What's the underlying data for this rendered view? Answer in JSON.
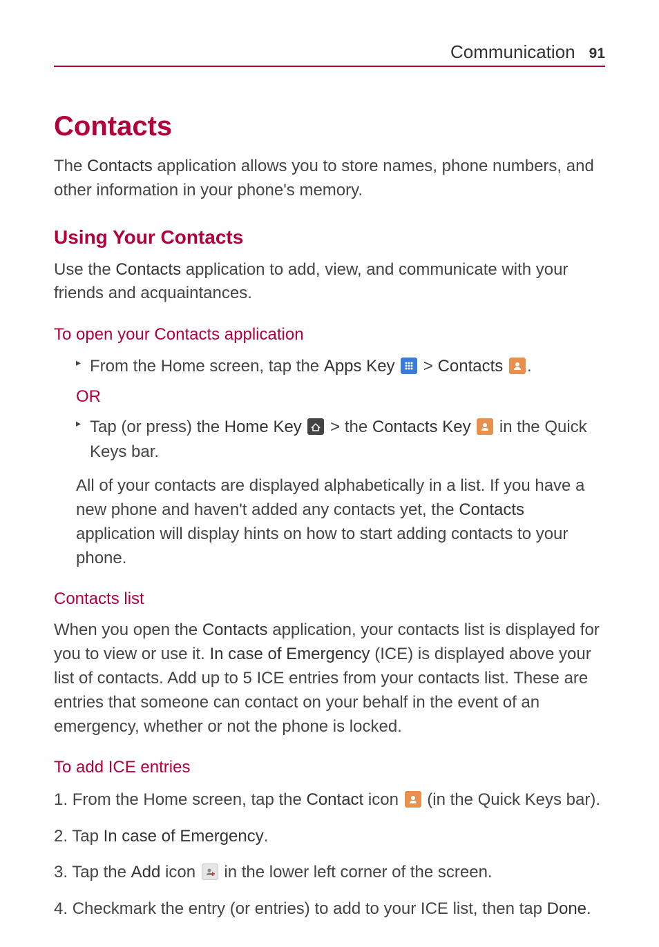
{
  "header": {
    "section": "Communication",
    "page_number": "91"
  },
  "title": "Contacts",
  "intro": {
    "prefix": "The ",
    "app_name": "Contacts",
    "suffix": " application allows you to store names, phone numbers, and other information in your phone's memory."
  },
  "using_heading": "Using Your Contacts",
  "using_text": {
    "prefix": "Use the ",
    "app_name": "Contacts",
    "suffix": " application to add, view, and communicate with your friends and acquaintances."
  },
  "open_heading": "To open your Contacts application",
  "open_bullet1": {
    "p1": "From the Home screen, tap the ",
    "apps_key": "Apps Key",
    "gt": " > ",
    "contacts": "Contacts",
    "period": "."
  },
  "or_label": "OR",
  "open_bullet2": {
    "p1": "Tap (or press) the ",
    "home_key": "Home Key",
    "gt": " > the ",
    "contacts_key": "Contacts Key",
    "suffix": " in the Quick Keys bar."
  },
  "open_para": {
    "p1": "All of your contacts are displayed alphabetically in a list. If you have a new phone and haven't added any contacts yet, the ",
    "contacts": "Contacts",
    "p2": " application will display hints on how to start adding contacts to your phone."
  },
  "list_heading": "Contacts list",
  "list_para": {
    "p1": "When you open the ",
    "contacts": "Contacts",
    "p2": " application, your contacts list is displayed for you to view or use it. ",
    "ice": "In case of Emergency",
    "p3": " (ICE) is displayed above your list of contacts. Add up to 5 ICE entries from your contacts list. These are entries that someone can contact on your behalf in the event of an emergency, whether or not the phone is locked."
  },
  "ice_heading": "To add ICE entries",
  "step1": {
    "num": "1. ",
    "p1": " From the Home screen, tap the ",
    "contact": "Contact",
    "p2": " icon ",
    "p3": " (in the Quick Keys bar)."
  },
  "step2": {
    "num": "2. ",
    "p1": " Tap ",
    "ice": "In case of Emergency",
    "p2": "."
  },
  "step3": {
    "num": "3. ",
    "p1": "Tap the ",
    "add": "Add",
    "p2": " icon ",
    "p3": " in the lower left corner of the screen."
  },
  "step4": {
    "num": "4. ",
    "p1": " Checkmark the entry (or entries) to add to your ICE list, then tap ",
    "done": "Done",
    "p2": "."
  },
  "icons": {
    "apps": "apps-key-icon",
    "contacts": "contacts-icon",
    "home": "home-key-icon",
    "contacts_quick": "contacts-quick-icon",
    "add": "add-contact-icon"
  }
}
